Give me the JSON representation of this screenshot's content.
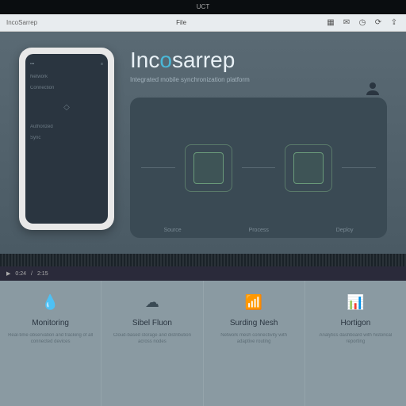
{
  "titlebar": {
    "label": "UCT"
  },
  "toolbar": {
    "left_label": "IncoSarrep",
    "tab": "File",
    "icons": [
      "grid-icon",
      "chat-icon",
      "clock-icon",
      "refresh-icon",
      "share-icon"
    ]
  },
  "hero": {
    "brand_prefix": "Inc",
    "brand_accent": "o",
    "brand_suffix": "sarrep",
    "tagline": "Integrated mobile synchronization platform",
    "phone": {
      "status_left": "•••",
      "status_right": "≡",
      "item1": "Network",
      "item2": "Connection",
      "item3": "Authorized",
      "item4": "Sync"
    },
    "diagram": {
      "label1": "Source",
      "label2": "Process",
      "label3": "Deploy"
    }
  },
  "video": {
    "time_current": "0:24",
    "time_total": "2:15"
  },
  "features": [
    {
      "icon": "droplet-icon",
      "title": "Monitoring",
      "desc": "Real-time observation and tracking of all connected devices"
    },
    {
      "icon": "cloud-icon",
      "title": "Sibel Fluon",
      "desc": "Cloud-based storage and distribution across nodes"
    },
    {
      "icon": "signal-icon",
      "title": "Surding Nesh",
      "desc": "Network mesh connectivity with adaptive routing"
    },
    {
      "icon": "chart-icon",
      "title": "Hortigon",
      "desc": "Analytics dashboard with historical reporting"
    }
  ]
}
